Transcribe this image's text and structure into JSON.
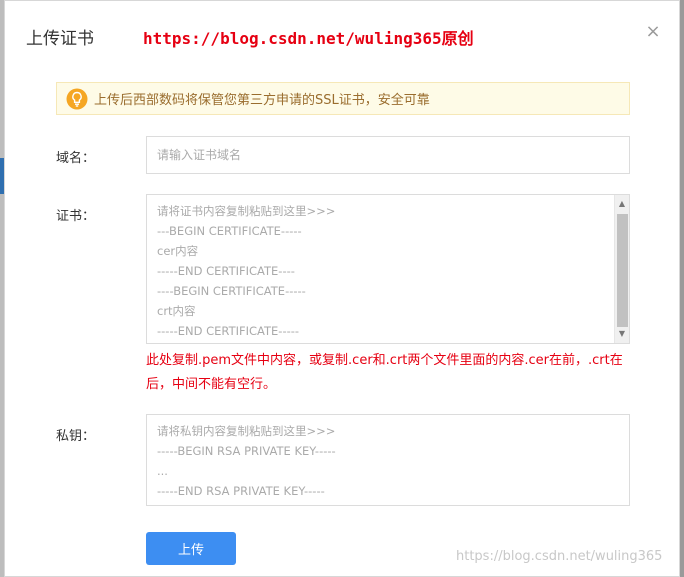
{
  "dialog": {
    "title": "上传证书",
    "close_glyph": "×"
  },
  "watermark_top": "https://blog.csdn.net/wuling365原创",
  "notice": {
    "icon": "lightbulb-icon",
    "text": "上传后西部数码将保管您第三方申请的SSL证书，安全可靠"
  },
  "form": {
    "domain": {
      "label": "域名：",
      "placeholder": "请输入证书域名",
      "value": ""
    },
    "certificate": {
      "label": "证书：",
      "lines": [
        "请将证书内容复制粘贴到这里>>>",
        "---BEGIN CERTIFICATE-----",
        "cer内容",
        "-----END CERTIFICATE----",
        "----BEGIN CERTIFICATE-----",
        "crt内容",
        "-----END CERTIFICATE-----"
      ]
    },
    "hint": "此处复制.pem文件中内容，或复制.cer和.crt两个文件里面的内容.cer在前，.crt在后，中间不能有空行。",
    "private_key": {
      "label": "私钥：",
      "lines": [
        "请将私钥内容复制粘贴到这里>>>",
        "-----BEGIN RSA PRIVATE KEY-----",
        "...",
        "-----END RSA PRIVATE KEY-----"
      ]
    },
    "submit_label": "上传"
  },
  "watermark_bottom": "https://blog.csdn.net/wuling365",
  "colors": {
    "accent": "#3d8ef2",
    "hint_red": "#e60012",
    "notice_bg": "#fefbe7",
    "notice_text": "#9a6d2e"
  }
}
